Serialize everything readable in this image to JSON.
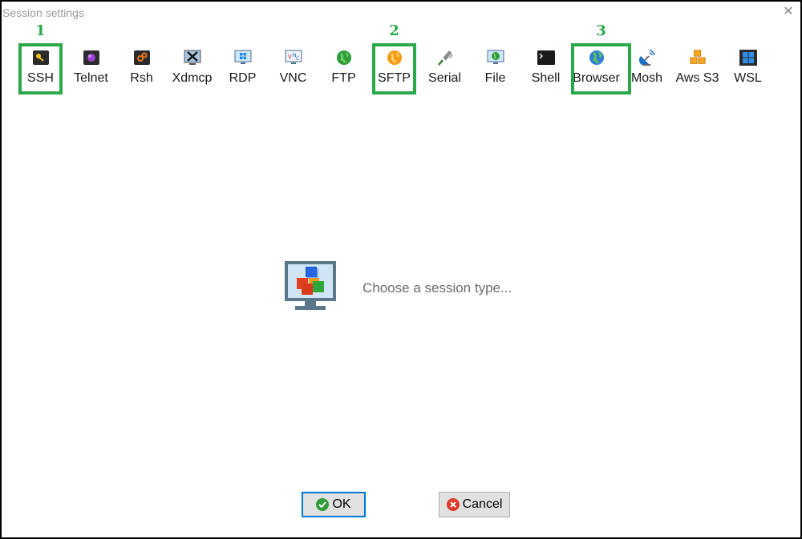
{
  "window": {
    "title": "Session settings"
  },
  "session_types": [
    {
      "label": "SSH",
      "icon": "ssh-key-icon",
      "highlight": "1"
    },
    {
      "label": "Telnet",
      "icon": "telnet-icon"
    },
    {
      "label": "Rsh",
      "icon": "rsh-icon"
    },
    {
      "label": "Xdmcp",
      "icon": "xdmcp-icon"
    },
    {
      "label": "RDP",
      "icon": "rdp-monitor-icon"
    },
    {
      "label": "VNC",
      "icon": "vnc-icon"
    },
    {
      "label": "FTP",
      "icon": "ftp-globe-icon"
    },
    {
      "label": "SFTP",
      "icon": "sftp-globe-icon",
      "highlight": "2"
    },
    {
      "label": "Serial",
      "icon": "serial-plug-icon"
    },
    {
      "label": "File",
      "icon": "file-globe-monitor-icon"
    },
    {
      "label": "Shell",
      "icon": "shell-terminal-icon"
    },
    {
      "label": "Browser",
      "icon": "browser-globe-icon",
      "highlight": "3"
    },
    {
      "label": "Mosh",
      "icon": "mosh-satellite-icon"
    },
    {
      "label": "Aws S3",
      "icon": "aws-s3-cubes-icon"
    },
    {
      "label": "WSL",
      "icon": "wsl-windows-icon"
    }
  ],
  "main": {
    "prompt": "Choose a session type..."
  },
  "buttons": {
    "ok": "OK",
    "cancel": "Cancel"
  },
  "colors": {
    "highlight": "#2aa84a",
    "ok_border": "#0078d7"
  }
}
